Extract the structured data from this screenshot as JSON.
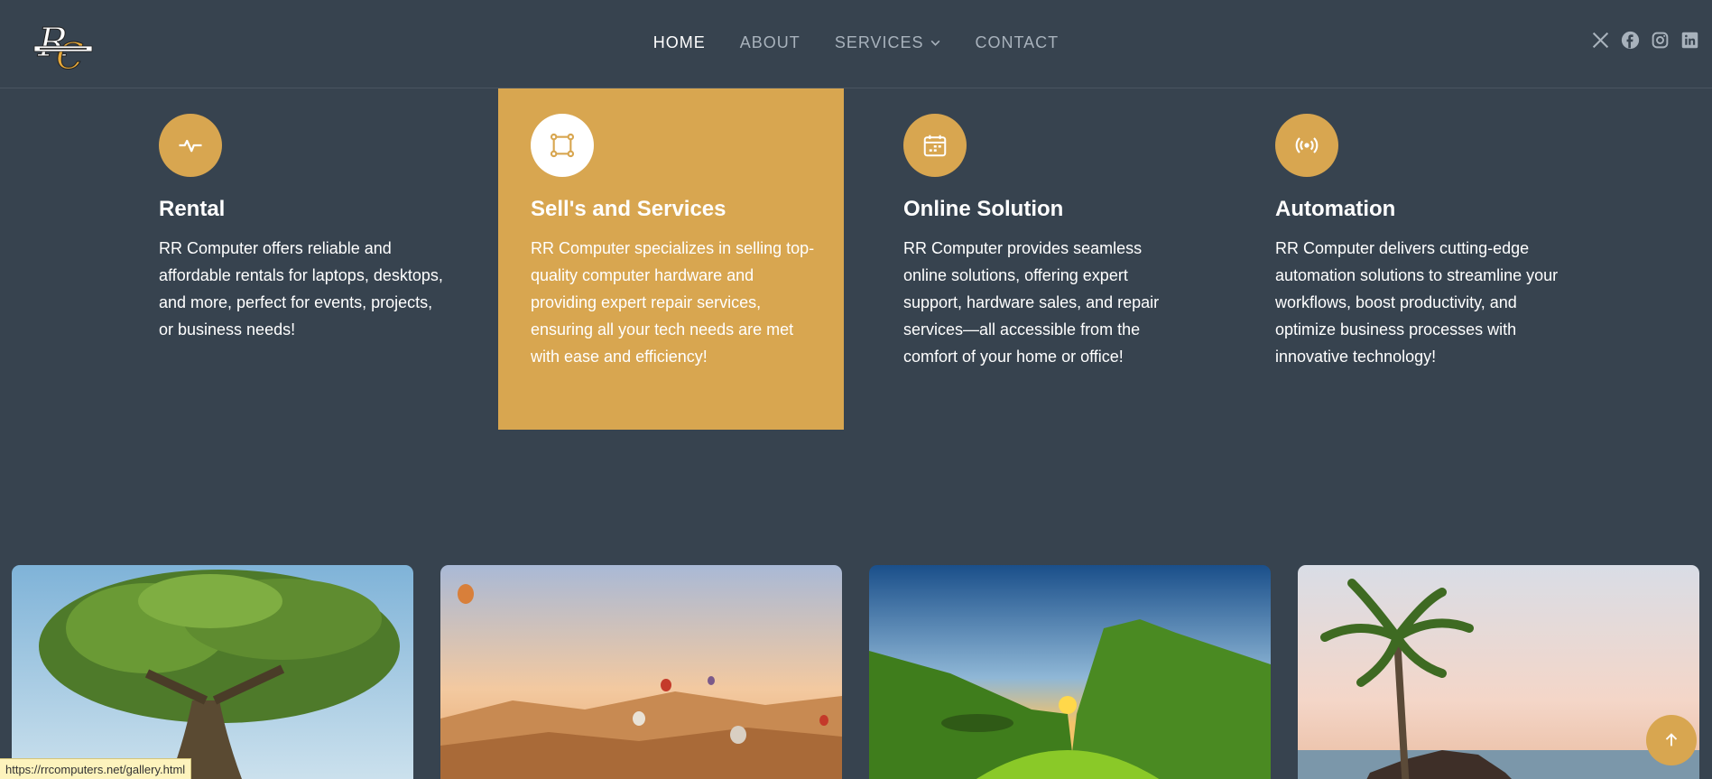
{
  "header": {
    "logo_alt": "RR Computers",
    "nav": [
      {
        "label": "HOME",
        "active": true
      },
      {
        "label": "ABOUT",
        "active": false
      },
      {
        "label": "SERVICES",
        "active": false,
        "dropdown": true
      },
      {
        "label": "CONTACT",
        "active": false
      }
    ],
    "social_icons": [
      "x-icon",
      "facebook-icon",
      "instagram-icon",
      "linkedin-icon"
    ]
  },
  "services": [
    {
      "icon": "activity-icon",
      "title": "Rental",
      "text": "RR Computer offers reliable and affordable rentals for laptops, desktops, and more, perfect for events, projects, or business needs!"
    },
    {
      "icon": "bounding-box-icon",
      "title": "Sell's and Services",
      "text": "RR Computer specializes in selling top-quality computer hardware and providing expert repair services, ensuring all your tech needs are met with ease and efficiency!",
      "highlighted": true
    },
    {
      "icon": "calendar-icon",
      "title": "Online Solution",
      "text": "RR Computer provides seamless online solutions, offering expert support, hardware sales, and repair services—all accessible from the comfort of your home or office!"
    },
    {
      "icon": "broadcast-icon",
      "title": "Automation",
      "text": "RR Computer delivers cutting-edge automation solutions to streamline your workflows, boost productivity, and optimize business processes with innovative technology!"
    }
  ],
  "gallery": [
    "tree-photo",
    "balloons-photo",
    "green-valley-photo",
    "palm-beach-photo"
  ],
  "status_bar_url": "https://rrcomputers.net/gallery.html",
  "colors": {
    "background": "#37434f",
    "accent": "#d8a650",
    "text": "#ffffff",
    "nav_inactive": "#a8b2bc"
  }
}
